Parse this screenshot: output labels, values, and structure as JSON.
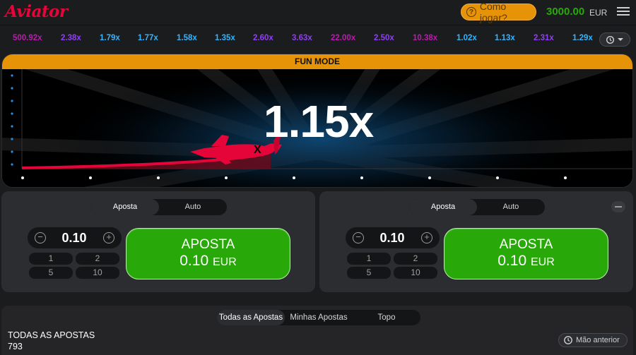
{
  "header": {
    "logo": "Aviator",
    "how_to_play": "Como jogar?",
    "balance": "3000.00",
    "currency": "EUR"
  },
  "history": [
    {
      "value": "500.92x",
      "color": "#c017b4"
    },
    {
      "value": "2.38x",
      "color": "#913ef8"
    },
    {
      "value": "1.79x",
      "color": "#34b4ff"
    },
    {
      "value": "1.77x",
      "color": "#34b4ff"
    },
    {
      "value": "1.58x",
      "color": "#34b4ff"
    },
    {
      "value": "1.35x",
      "color": "#34b4ff"
    },
    {
      "value": "2.60x",
      "color": "#913ef8"
    },
    {
      "value": "3.63x",
      "color": "#913ef8"
    },
    {
      "value": "22.00x",
      "color": "#c017b4"
    },
    {
      "value": "2.50x",
      "color": "#913ef8"
    },
    {
      "value": "10.38x",
      "color": "#c017b4"
    },
    {
      "value": "1.02x",
      "color": "#34b4ff"
    },
    {
      "value": "1.13x",
      "color": "#34b4ff"
    },
    {
      "value": "2.31x",
      "color": "#913ef8"
    },
    {
      "value": "1.29x",
      "color": "#34b4ff"
    }
  ],
  "game": {
    "mode_banner": "FUN MODE",
    "multiplier": "1.15x"
  },
  "panels": [
    {
      "tab_bet": "Aposta",
      "tab_auto": "Auto",
      "amount": "0.10",
      "quick": [
        "1",
        "2",
        "5",
        "10"
      ],
      "button_label": "APOSTA",
      "button_amount": "0.10",
      "button_currency": "EUR"
    },
    {
      "tab_bet": "Aposta",
      "tab_auto": "Auto",
      "amount": "0.10",
      "quick": [
        "1",
        "2",
        "5",
        "10"
      ],
      "button_label": "APOSTA",
      "button_amount": "0.10",
      "button_currency": "EUR"
    }
  ],
  "bets": {
    "tabs": [
      "Todas as Apostas",
      "Minhas Apostas",
      "Topo"
    ],
    "title": "TODAS AS APOSTAS",
    "count": "793",
    "previous_hand": "Mão anterior"
  }
}
